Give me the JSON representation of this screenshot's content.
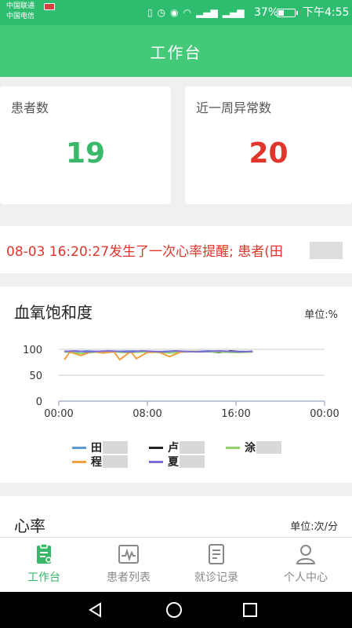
{
  "status_bar": {
    "carrier1": "中国联通",
    "carrier2": "中国电信",
    "battery_percent": "37%",
    "time": "下午4:55"
  },
  "header": {
    "title": "工作台"
  },
  "stats": {
    "patients_label": "患者数",
    "patients_value": "19",
    "abnormal_label": "近一周异常数",
    "abnormal_value": "20"
  },
  "alert": {
    "text": "08-03 16:20:27发生了一次心率提醒; 患者(田"
  },
  "spo2_chart": {
    "title": "血氧饱和度",
    "unit": "单位:%"
  },
  "heart_chart": {
    "title": "心率",
    "unit": "单位:次/分"
  },
  "chart_data": {
    "type": "line",
    "title": "血氧饱和度",
    "ylabel": "单位:%",
    "ylim": [
      0,
      100
    ],
    "yticks": [
      "100",
      "50",
      "0"
    ],
    "xticks": [
      "00:00",
      "08:00",
      "16:00",
      "00:00"
    ],
    "xlim": [
      "00:00",
      "24:00"
    ],
    "grid": true,
    "legend_position": "bottom",
    "series": [
      {
        "name": "田",
        "color": "#5b9bd5",
        "x": [
          0.5,
          1.5,
          2.5,
          3.5,
          4.5,
          5.5,
          6.5,
          7.5,
          8.5,
          9.5,
          10.5,
          11.5,
          12.5,
          13.5,
          14.5,
          15.5,
          16.5,
          17.5
        ],
        "values": [
          96,
          95,
          97,
          96,
          95,
          96,
          97,
          96,
          95,
          96,
          97,
          95,
          96,
          97,
          96,
          95,
          96,
          95
        ]
      },
      {
        "name": "卢",
        "color": "#222222",
        "x": [
          13.5,
          14.5,
          15.5,
          16.5,
          17.5
        ],
        "values": [
          96,
          94,
          97,
          95,
          96
        ]
      },
      {
        "name": "涂",
        "color": "#8fd46a",
        "x": [
          0.5,
          2,
          4,
          6,
          8,
          10,
          12,
          14,
          16,
          17.5
        ],
        "values": [
          95,
          92,
          96,
          94,
          95,
          93,
          96,
          95,
          94,
          95
        ]
      },
      {
        "name": "程",
        "color": "#f0a040",
        "x": [
          0.5,
          1,
          2,
          3,
          4,
          5,
          5.5,
          6.5,
          7,
          8,
          9,
          10,
          11,
          12,
          13
        ],
        "values": [
          80,
          95,
          88,
          96,
          93,
          95,
          80,
          96,
          82,
          94,
          95,
          86,
          95,
          96,
          95
        ]
      },
      {
        "name": "夏",
        "color": "#7b6cd8",
        "x": [
          0.5,
          1.5,
          2.5,
          3.5,
          4.5,
          5.5,
          6.5,
          7.5,
          8.5,
          9.5,
          10.5,
          11.5,
          12.5,
          13.5,
          14.5,
          15.5,
          16.5,
          17.5
        ],
        "values": [
          96,
          97,
          95,
          96,
          97,
          96,
          95,
          97,
          96,
          95,
          97,
          96,
          95,
          96,
          97,
          96,
          95,
          96
        ]
      }
    ]
  },
  "tabs": [
    {
      "label": "工作台",
      "icon": "clipboard-icon",
      "active": true
    },
    {
      "label": "患者列表",
      "icon": "pulse-icon",
      "active": false
    },
    {
      "label": "就诊记录",
      "icon": "document-icon",
      "active": false
    },
    {
      "label": "个人中心",
      "icon": "user-icon",
      "active": false
    }
  ],
  "colors": {
    "primary": "#44c979",
    "status_bar": "#2ebd6f",
    "alert": "#e0362c"
  }
}
